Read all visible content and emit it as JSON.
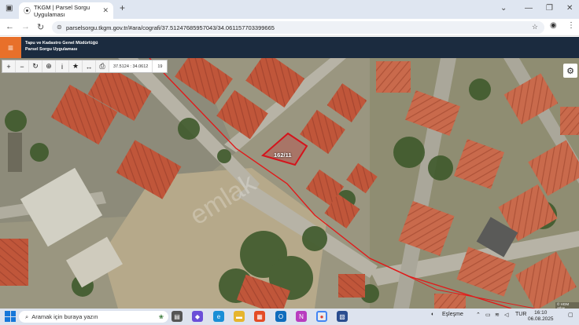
{
  "browser": {
    "tab_title": "TKGM | Parsel Sorgu Uygulaması",
    "tab_close": "✕",
    "new_tab": "+",
    "url": "parselsorgu.tkgm.gov.tr/#ara/cografi/37.51247685957043/34.061157703399665",
    "window_controls": [
      "⌄",
      "—",
      "❐",
      "✕"
    ]
  },
  "app": {
    "org_line1": "Tapu ve Kadastro Genel Müdürlüğü",
    "org_line2": "Parsel Sorgu Uygulaması",
    "menu_icon": "≡"
  },
  "toolbar": {
    "buttons": [
      "+",
      "−",
      "↻",
      "⊕",
      "i",
      "★",
      "↔",
      "⎙"
    ],
    "coords": "37.5124 : 34.0612",
    "zoom": "19"
  },
  "map": {
    "parcel_label": "162/11",
    "attribution": "© HGM Atlas",
    "watermark": "emlak"
  },
  "taskbar": {
    "search_placeholder": "Aramak için buraya yazın",
    "sync_label": "Eşleşme",
    "language": "TUR",
    "time": "16:10",
    "date": "06.08.2025"
  },
  "colors": {
    "header_bg": "#1b2b3f",
    "menu_accent": "#e8702a",
    "parcel_stroke": "#d4141c",
    "boundary_line": "#e01b1b"
  }
}
